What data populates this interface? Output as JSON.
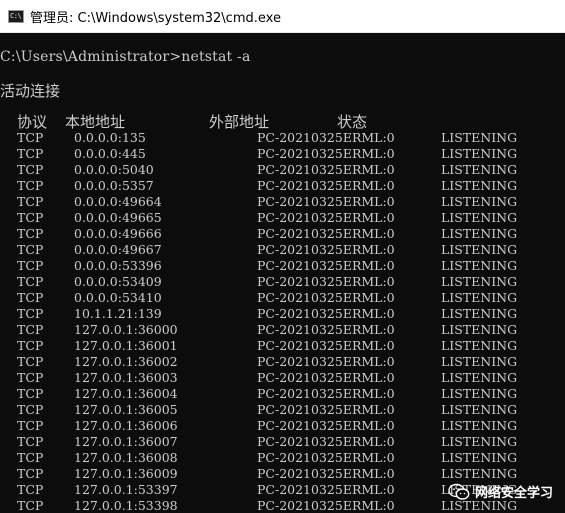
{
  "window": {
    "title": "管理员: C:\\Windows\\system32\\cmd.exe",
    "icon": "cmd-icon",
    "icon_text": "C:\\"
  },
  "console": {
    "prompt": "C:\\Users\\Administrator>netstat -a",
    "section_title": "活动连接",
    "headers": {
      "protocol": "协议",
      "local_address": "本地地址",
      "foreign_address": "外部地址",
      "state": "状态"
    },
    "rows": [
      {
        "proto": "TCP",
        "local": "0.0.0.0:135",
        "foreign": "PC-20210325ERML:0",
        "state": "LISTENING"
      },
      {
        "proto": "TCP",
        "local": "0.0.0.0:445",
        "foreign": "PC-20210325ERML:0",
        "state": "LISTENING"
      },
      {
        "proto": "TCP",
        "local": "0.0.0.0:5040",
        "foreign": "PC-20210325ERML:0",
        "state": "LISTENING"
      },
      {
        "proto": "TCP",
        "local": "0.0.0.0:5357",
        "foreign": "PC-20210325ERML:0",
        "state": "LISTENING"
      },
      {
        "proto": "TCP",
        "local": "0.0.0.0:49664",
        "foreign": "PC-20210325ERML:0",
        "state": "LISTENING"
      },
      {
        "proto": "TCP",
        "local": "0.0.0.0:49665",
        "foreign": "PC-20210325ERML:0",
        "state": "LISTENING"
      },
      {
        "proto": "TCP",
        "local": "0.0.0.0:49666",
        "foreign": "PC-20210325ERML:0",
        "state": "LISTENING"
      },
      {
        "proto": "TCP",
        "local": "0.0.0.0:49667",
        "foreign": "PC-20210325ERML:0",
        "state": "LISTENING"
      },
      {
        "proto": "TCP",
        "local": "0.0.0.0:53396",
        "foreign": "PC-20210325ERML:0",
        "state": "LISTENING"
      },
      {
        "proto": "TCP",
        "local": "0.0.0.0:53409",
        "foreign": "PC-20210325ERML:0",
        "state": "LISTENING"
      },
      {
        "proto": "TCP",
        "local": "0.0.0.0:53410",
        "foreign": "PC-20210325ERML:0",
        "state": "LISTENING"
      },
      {
        "proto": "TCP",
        "local": "10.1.1.21:139",
        "foreign": "PC-20210325ERML:0",
        "state": "LISTENING"
      },
      {
        "proto": "TCP",
        "local": "127.0.0.1:36000",
        "foreign": "PC-20210325ERML:0",
        "state": "LISTENING"
      },
      {
        "proto": "TCP",
        "local": "127.0.0.1:36001",
        "foreign": "PC-20210325ERML:0",
        "state": "LISTENING"
      },
      {
        "proto": "TCP",
        "local": "127.0.0.1:36002",
        "foreign": "PC-20210325ERML:0",
        "state": "LISTENING"
      },
      {
        "proto": "TCP",
        "local": "127.0.0.1:36003",
        "foreign": "PC-20210325ERML:0",
        "state": "LISTENING"
      },
      {
        "proto": "TCP",
        "local": "127.0.0.1:36004",
        "foreign": "PC-20210325ERML:0",
        "state": "LISTENING"
      },
      {
        "proto": "TCP",
        "local": "127.0.0.1:36005",
        "foreign": "PC-20210325ERML:0",
        "state": "LISTENING"
      },
      {
        "proto": "TCP",
        "local": "127.0.0.1:36006",
        "foreign": "PC-20210325ERML:0",
        "state": "LISTENING"
      },
      {
        "proto": "TCP",
        "local": "127.0.0.1:36007",
        "foreign": "PC-20210325ERML:0",
        "state": "LISTENING"
      },
      {
        "proto": "TCP",
        "local": "127.0.0.1:36008",
        "foreign": "PC-20210325ERML:0",
        "state": "LISTENING"
      },
      {
        "proto": "TCP",
        "local": "127.0.0.1:36009",
        "foreign": "PC-20210325ERML:0",
        "state": "LISTENING"
      },
      {
        "proto": "TCP",
        "local": "127.0.0.1:53397",
        "foreign": "PC-20210325ERML:0",
        "state": "LISTENING"
      },
      {
        "proto": "TCP",
        "local": "127.0.0.1:53398",
        "foreign": "PC-20210325ERML:0",
        "state": "LISTENING"
      }
    ]
  },
  "watermark": {
    "icon": "wechat-icon",
    "text": "网络安全学习"
  },
  "colors": {
    "console_bg": "#0c0c0c",
    "console_fg": "#cccccc",
    "titlebar_bg": "#ffffff"
  }
}
